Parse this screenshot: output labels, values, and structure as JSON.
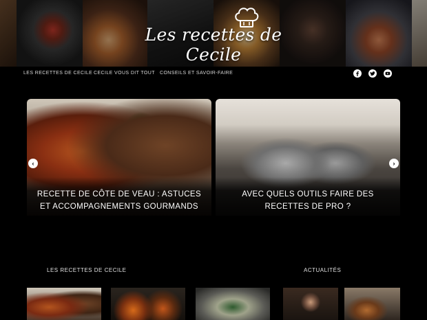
{
  "header": {
    "logo_text": "Les recettes de Cecile",
    "logo_icon": "chef-hat-icon"
  },
  "nav": {
    "items": [
      {
        "label": "LES RECETTES DE CECILE"
      },
      {
        "label": "CECILE VOUS DIT TOUT"
      },
      {
        "label": "CONSEILS ET SAVOIR-FAIRE"
      }
    ],
    "social": [
      "facebook-icon",
      "twitter-icon",
      "youtube-icon"
    ]
  },
  "slider": {
    "slides": [
      {
        "title": "RECETTE DE CÔTE DE VEAU : ASTUCES ET ACCOMPAGNEMENTS GOURMANDS"
      },
      {
        "title": "AVEC QUELS OUTILS FAIRE DES RECETTES DE PRO ?"
      }
    ],
    "prev_icon": "chevron-left-icon",
    "next_icon": "chevron-right-icon"
  },
  "sections": {
    "left_title": "LES RECETTES DE CECILE",
    "right_title": "ACTUALITÉS"
  },
  "colors": {
    "background": "#000000",
    "text": "#ffffff",
    "nav_text": "#d8d8d8"
  }
}
